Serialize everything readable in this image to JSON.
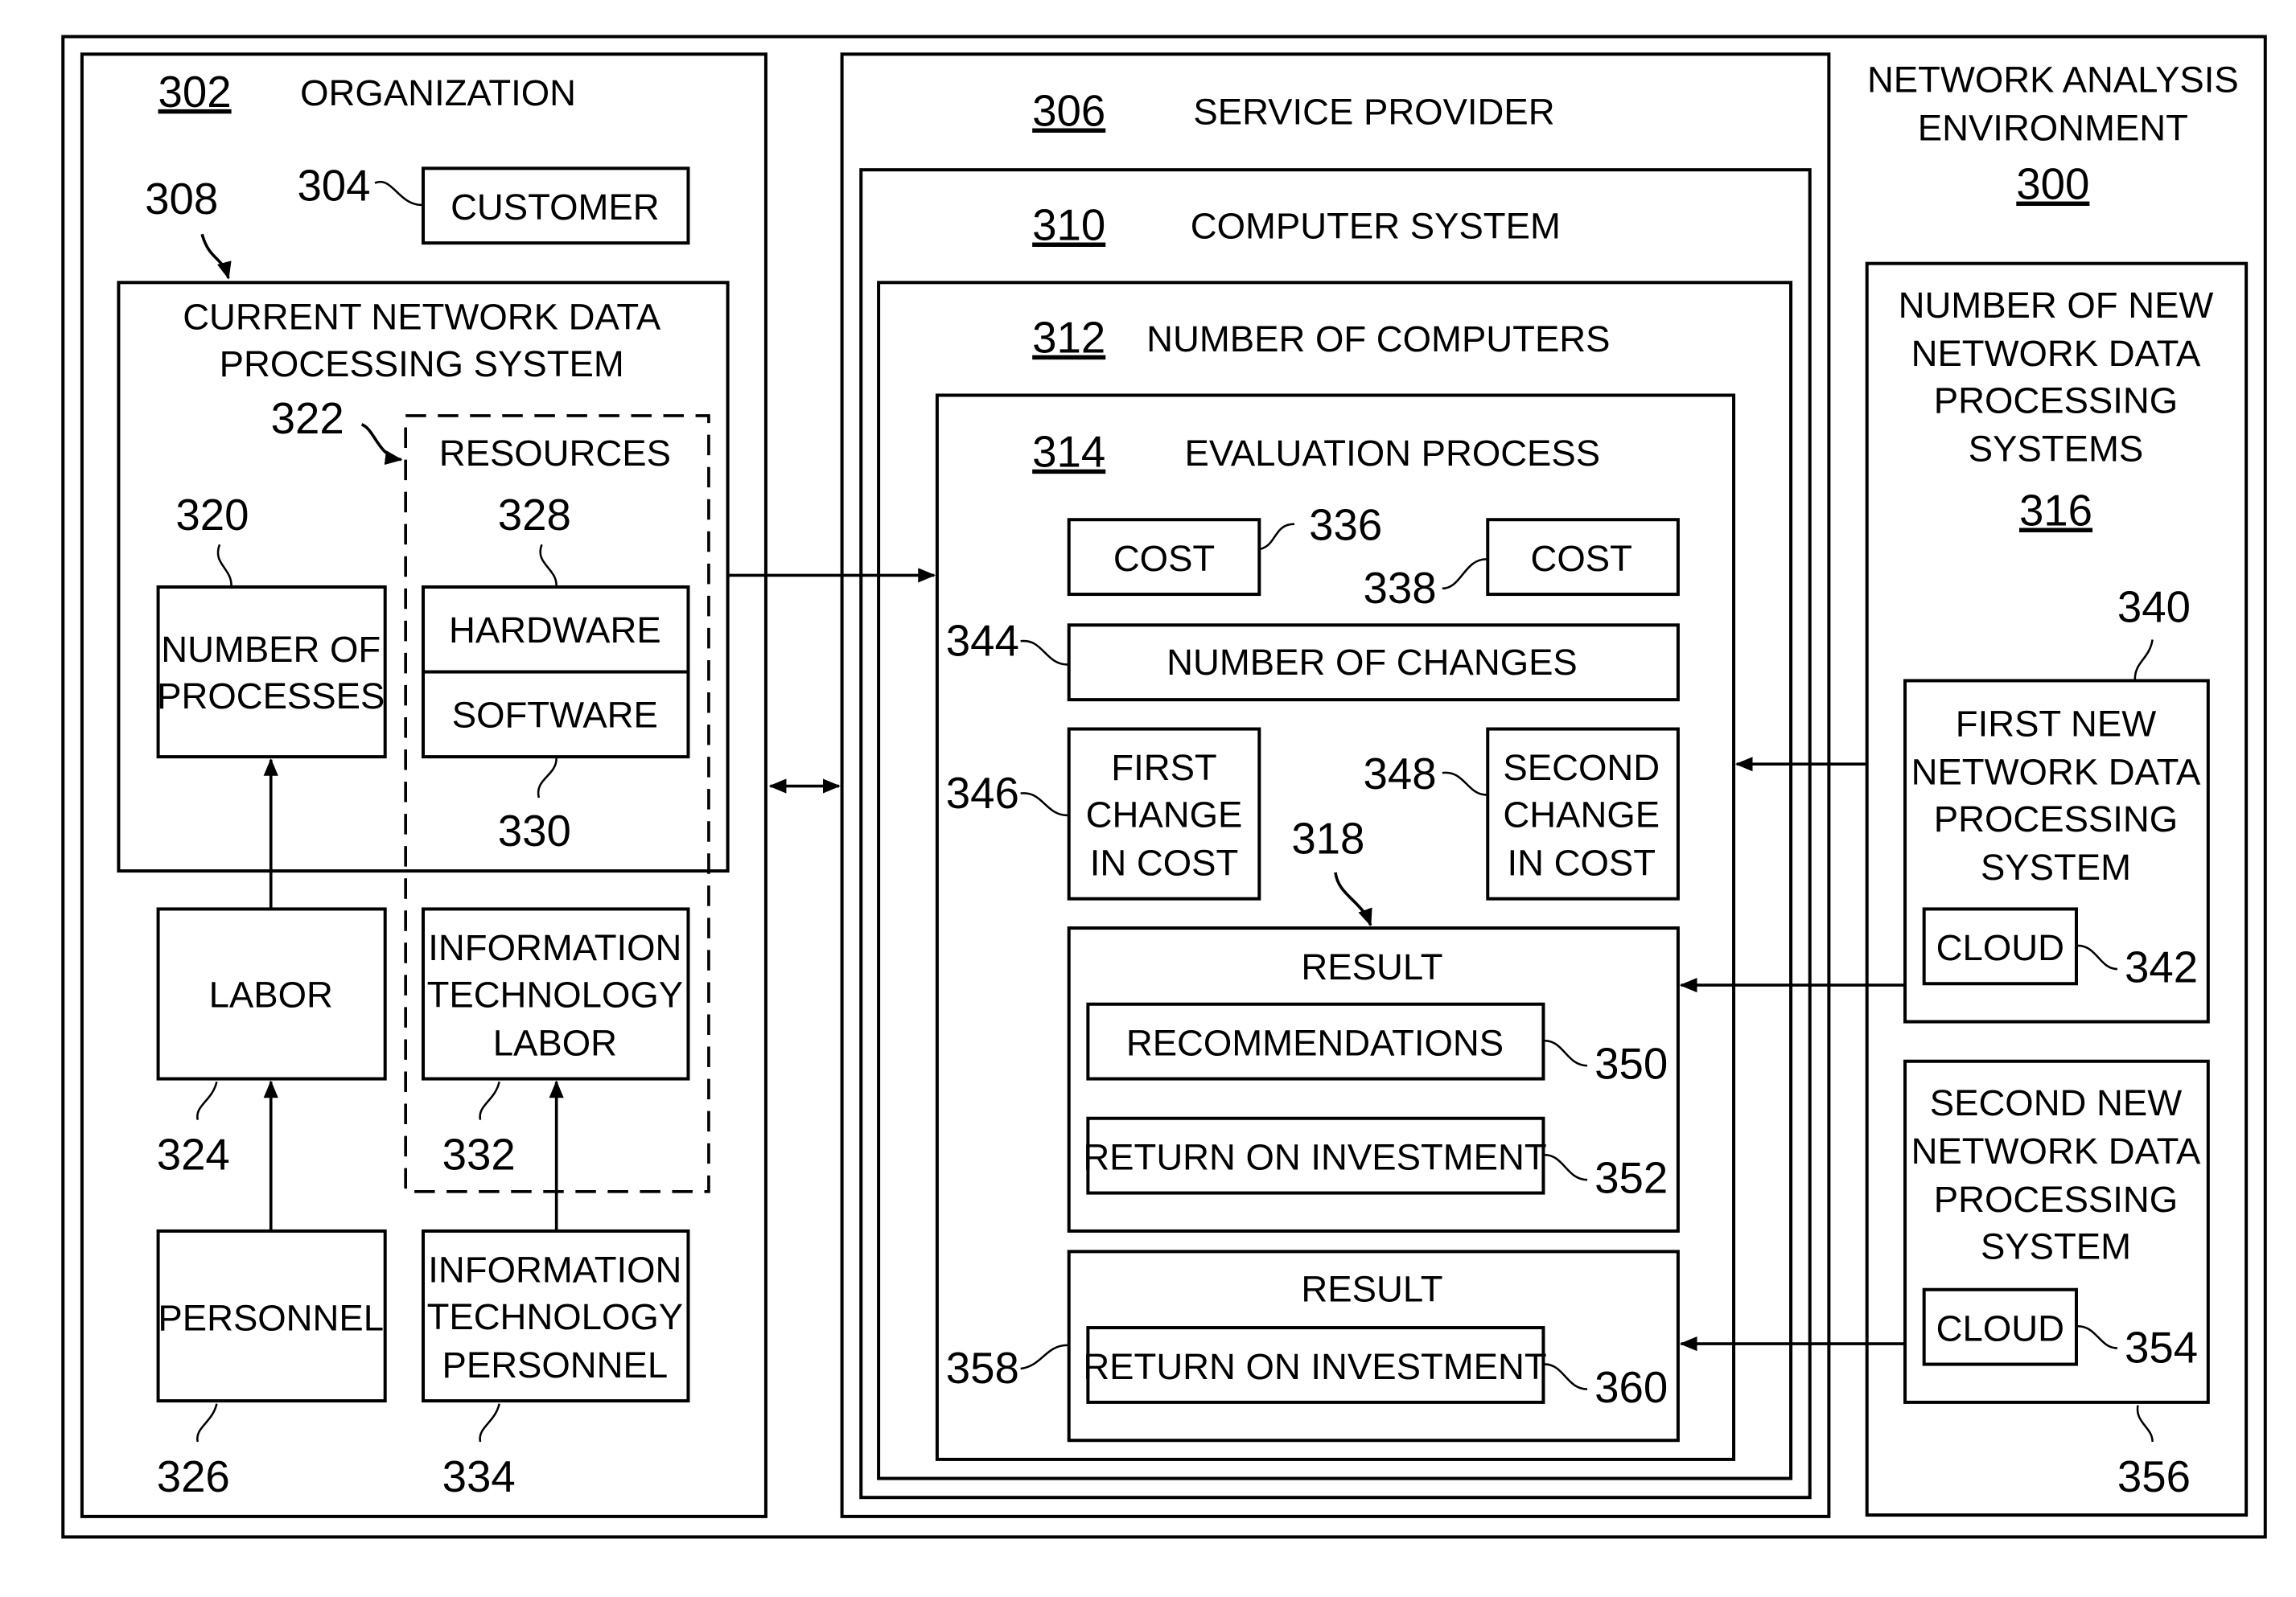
{
  "environment": {
    "title_line1": "NETWORK ANALYSIS",
    "title_line2": "ENVIRONMENT",
    "ref": "300"
  },
  "organization": {
    "ref": "302",
    "title": "ORGANIZATION",
    "customer": {
      "ref": "304",
      "label": "CUSTOMER"
    },
    "current_system": {
      "ref": "308",
      "line1": "CURRENT NETWORK DATA",
      "line2": "PROCESSING SYSTEM"
    },
    "processes": {
      "ref": "320",
      "line1": "NUMBER OF",
      "line2": "PROCESSES"
    },
    "resources": {
      "ref": "322",
      "label": "RESOURCES"
    },
    "hardware": {
      "ref": "328",
      "label": "HARDWARE"
    },
    "software": {
      "ref": "330",
      "label": "SOFTWARE"
    },
    "labor": {
      "ref": "324",
      "label": "LABOR"
    },
    "it_labor": {
      "ref": "332",
      "line1": "INFORMATION",
      "line2": "TECHNOLOGY",
      "line3": "LABOR"
    },
    "personnel": {
      "ref": "326",
      "label": "PERSONNEL"
    },
    "it_personnel": {
      "ref": "334",
      "line1": "INFORMATION",
      "line2": "TECHNOLOGY",
      "line3": "PERSONNEL"
    }
  },
  "service_provider": {
    "ref": "306",
    "title": "SERVICE PROVIDER",
    "computer_system": {
      "ref": "310",
      "title": "COMPUTER SYSTEM"
    },
    "computers": {
      "ref": "312",
      "title": "NUMBER OF COMPUTERS"
    },
    "evaluation": {
      "ref": "314",
      "title": "EVALUATION PROCESS",
      "cost1": {
        "ref": "336",
        "label": "COST"
      },
      "cost2": {
        "ref": "338",
        "label": "COST"
      },
      "changes": {
        "ref": "344",
        "label": "NUMBER OF CHANGES"
      },
      "first_change": {
        "ref": "346",
        "line1": "FIRST",
        "line2": "CHANGE",
        "line3": "IN COST"
      },
      "second_change": {
        "ref": "348",
        "line1": "SECOND",
        "line2": "CHANGE",
        "line3": "IN COST"
      },
      "result1": {
        "ref": "318",
        "title": "RESULT",
        "recommendations": {
          "ref": "350",
          "label": "RECOMMENDATIONS"
        },
        "roi": {
          "ref": "352",
          "label": "RETURN ON INVESTMENT"
        }
      },
      "result2": {
        "ref": "358",
        "title": "RESULT",
        "roi": {
          "ref": "360",
          "label": "RETURN ON INVESTMENT"
        }
      }
    }
  },
  "new_systems": {
    "ref": "316",
    "line1": "NUMBER OF NEW",
    "line2": "NETWORK DATA",
    "line3": "PROCESSING",
    "line4": "SYSTEMS",
    "first": {
      "ref": "340",
      "line1": "FIRST NEW",
      "line2": "NETWORK DATA",
      "line3": "PROCESSING",
      "line4": "SYSTEM",
      "cloud": {
        "ref": "342",
        "label": "CLOUD"
      }
    },
    "second": {
      "ref": "356",
      "line1": "SECOND NEW",
      "line2": "NETWORK DATA",
      "line3": "PROCESSING",
      "line4": "SYSTEM",
      "cloud": {
        "ref": "354",
        "label": "CLOUD"
      }
    }
  }
}
